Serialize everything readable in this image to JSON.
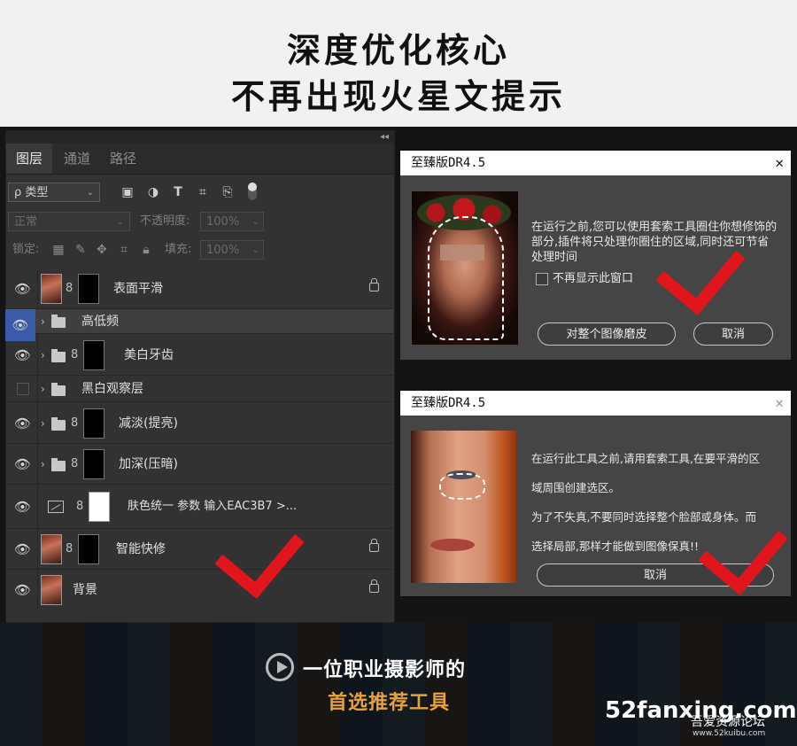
{
  "headline": {
    "line1": "深度优化核心",
    "line2": "不再出现火星文提示"
  },
  "layers_panel": {
    "tabs": [
      {
        "label": "图层"
      },
      {
        "label": "通道"
      },
      {
        "label": "路径"
      }
    ],
    "filter": {
      "value": "ρ 类型",
      "icon": "search-icon"
    },
    "blend_mode": "正常",
    "opacity_label": "不透明度:",
    "opacity_value": "100%",
    "lock_label": "锁定:",
    "fill_label": "填充:",
    "fill_value": "100%",
    "layers": [
      {
        "name": "表面平滑",
        "visible": true,
        "locked": true
      },
      {
        "name": "高低频",
        "visible": true,
        "group": true
      },
      {
        "name": "美白牙齿",
        "visible": true,
        "group": true
      },
      {
        "name": "黑白观察层",
        "visible": false,
        "group": true
      },
      {
        "name": "减淡(提亮)",
        "visible": true,
        "group": true
      },
      {
        "name": "加深(压暗)",
        "visible": true,
        "group": true
      },
      {
        "name": "肤色统一 参数  输入EAC3B7 >...",
        "visible": true
      },
      {
        "name": "智能快修",
        "visible": true,
        "locked": true
      },
      {
        "name": "背景",
        "visible": true,
        "locked": true
      }
    ]
  },
  "dialog1": {
    "title": "至臻版DR4.5",
    "message": "在运行之前,您可以使用套索工具圈住你想修饰的部分,插件将只处理你圈住的区域,同时还可节省处理时间",
    "checkbox_label": "不再显示此窗口",
    "primary_button": "对整个图像磨皮",
    "cancel_button": "取消"
  },
  "dialog2": {
    "title": "至臻版DR4.5",
    "message_lines": [
      "在运行此工具之前,请用套索工具,在要平滑的区",
      "域周围创建选区。",
      "为了不失真,不要同时选择整个脸部或身体。而",
      "选择局部,那样才能做到图像保真!!"
    ],
    "cancel_button": "取消"
  },
  "bottom": {
    "slogan_line1": "一位职业摄影师的",
    "slogan_line2": "首选推荐工具"
  },
  "watermark": {
    "site": "52fanxing.com",
    "cn": "吾爱资源论坛",
    "url": "www.52kuibu.com"
  },
  "colors": {
    "check_red": "#e0161c",
    "accent_orange": "#e8a23a",
    "layer_highlight": "#3b5ba8"
  }
}
